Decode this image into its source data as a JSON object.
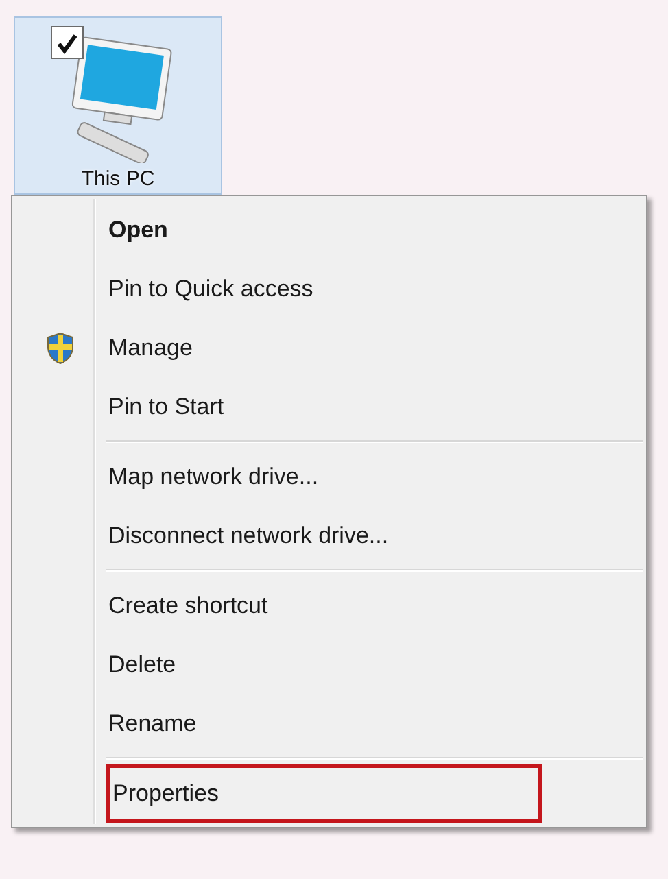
{
  "desktop_icon": {
    "label": "This PC",
    "selected": true,
    "checked": true
  },
  "context_menu": [
    {
      "kind": "item",
      "label": "Open",
      "default": true,
      "elevated": false,
      "highlighted": false
    },
    {
      "kind": "item",
      "label": "Pin to Quick access",
      "default": false,
      "elevated": false,
      "highlighted": false
    },
    {
      "kind": "item",
      "label": "Manage",
      "default": false,
      "elevated": true,
      "highlighted": false
    },
    {
      "kind": "item",
      "label": "Pin to Start",
      "default": false,
      "elevated": false,
      "highlighted": false
    },
    {
      "kind": "separator"
    },
    {
      "kind": "item",
      "label": "Map network drive...",
      "default": false,
      "elevated": false,
      "highlighted": false
    },
    {
      "kind": "item",
      "label": "Disconnect network drive...",
      "default": false,
      "elevated": false,
      "highlighted": false
    },
    {
      "kind": "separator"
    },
    {
      "kind": "item",
      "label": "Create shortcut",
      "default": false,
      "elevated": false,
      "highlighted": false
    },
    {
      "kind": "item",
      "label": "Delete",
      "default": false,
      "elevated": false,
      "highlighted": false
    },
    {
      "kind": "item",
      "label": "Rename",
      "default": false,
      "elevated": false,
      "highlighted": false
    },
    {
      "kind": "separator"
    },
    {
      "kind": "item",
      "label": "Properties",
      "default": false,
      "elevated": false,
      "highlighted": true
    }
  ]
}
